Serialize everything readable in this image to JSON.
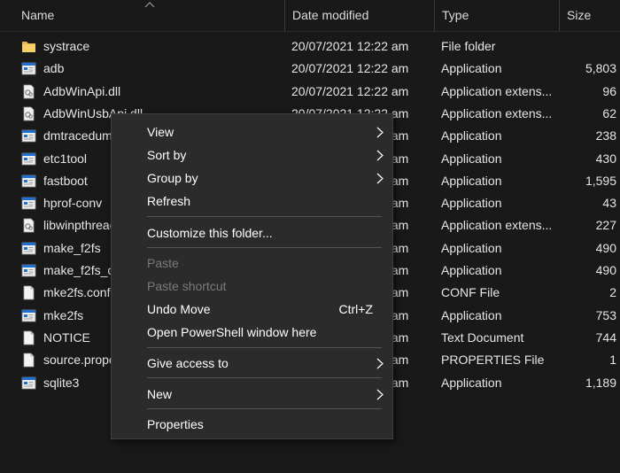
{
  "header": {
    "name": "Name",
    "date_modified": "Date modified",
    "type": "Type",
    "size": "Size"
  },
  "files": [
    {
      "icon": "folder-icon",
      "name": "systrace",
      "date": "20/07/2021 12:22 am",
      "type": "File folder",
      "size": ""
    },
    {
      "icon": "application-icon",
      "name": "adb",
      "date": "20/07/2021 12:22 am",
      "type": "Application",
      "size": "5,803"
    },
    {
      "icon": "dll-icon",
      "name": "AdbWinApi.dll",
      "date": "20/07/2021 12:22 am",
      "type": "Application extens...",
      "size": "96"
    },
    {
      "icon": "dll-icon",
      "name": "AdbWinUsbApi.dll",
      "date": "20/07/2021 12:22 am",
      "type": "Application extens...",
      "size": "62"
    },
    {
      "icon": "application-icon",
      "name": "dmtracedump",
      "date": "20/07/2021 12:22 am",
      "type": "Application",
      "size": "238"
    },
    {
      "icon": "application-icon",
      "name": "etc1tool",
      "date": "20/07/2021 12:22 am",
      "type": "Application",
      "size": "430"
    },
    {
      "icon": "application-icon",
      "name": "fastboot",
      "date": "20/07/2021 12:22 am",
      "type": "Application",
      "size": "1,595"
    },
    {
      "icon": "application-icon",
      "name": "hprof-conv",
      "date": "20/07/2021 12:22 am",
      "type": "Application",
      "size": "43"
    },
    {
      "icon": "dll-icon",
      "name": "libwinpthread-1.dll",
      "date": "20/07/2021 12:22 am",
      "type": "Application extens...",
      "size": "227"
    },
    {
      "icon": "application-icon",
      "name": "make_f2fs",
      "date": "20/07/2021 12:22 am",
      "type": "Application",
      "size": "490"
    },
    {
      "icon": "application-icon",
      "name": "make_f2fs_casefold",
      "date": "20/07/2021 12:22 am",
      "type": "Application",
      "size": "490"
    },
    {
      "icon": "document-icon",
      "name": "mke2fs.conf",
      "date": "20/07/2021 12:22 am",
      "type": "CONF File",
      "size": "2"
    },
    {
      "icon": "application-icon",
      "name": "mke2fs",
      "date": "20/07/2021 12:22 am",
      "type": "Application",
      "size": "753"
    },
    {
      "icon": "document-icon",
      "name": "NOTICE",
      "date": "20/07/2021 12:22 am",
      "type": "Text Document",
      "size": "744"
    },
    {
      "icon": "document-icon",
      "name": "source.properties",
      "date": "20/07/2021 12:22 am",
      "type": "PROPERTIES File",
      "size": "1"
    },
    {
      "icon": "application-icon",
      "name": "sqlite3",
      "date": "20/07/2021 12:22 am",
      "type": "Application",
      "size": "1,189"
    }
  ],
  "context_menu": {
    "view": "View",
    "sort_by": "Sort by",
    "group_by": "Group by",
    "refresh": "Refresh",
    "customize": "Customize this folder...",
    "paste": "Paste",
    "paste_shortcut": "Paste shortcut",
    "undo_move": "Undo Move",
    "undo_move_shortcut": "Ctrl+Z",
    "open_powershell": "Open PowerShell window here",
    "give_access": "Give access to",
    "new": "New",
    "properties": "Properties"
  },
  "colors": {
    "background": "#191919",
    "menu_background": "#2b2b2b",
    "folder": "#e8b94a",
    "app_icon_blue": "#1e6fd0",
    "disabled_text": "#7a7a7a"
  }
}
